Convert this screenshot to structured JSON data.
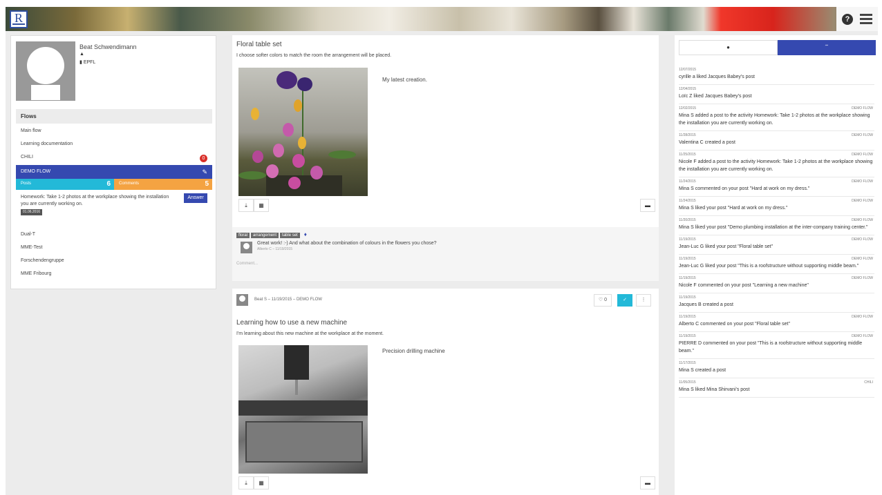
{
  "header": {
    "logo_letter": "R",
    "help_icon_label": "?"
  },
  "profile": {
    "name": "Beat Schwendimann",
    "org": "EPFL"
  },
  "flows": {
    "heading": "Flows",
    "items": [
      {
        "label": "Main flow"
      },
      {
        "label": "Learning documentation"
      },
      {
        "label": "CHILI",
        "badge": "0"
      }
    ],
    "active": {
      "label": "DEMO FLOW",
      "posts_label": "Posts",
      "posts_count": "6",
      "comments_label": "Comments",
      "comments_count": "5",
      "homework_text": "Homework: Take 1-2 photos at the workplace showing the installation you are currently working on.",
      "homework_date": "01.06.2016",
      "answer_label": "Answer"
    },
    "items_after": [
      {
        "label": "Dual-T"
      },
      {
        "label": "MME-Test"
      },
      {
        "label": "Forschendengruppe"
      },
      {
        "label": "MME Fribourg"
      }
    ]
  },
  "posts": [
    {
      "title": "Floral table set",
      "description": "I choose softer colors to match the room the arrangement will be placed.",
      "caption": "My latest creation.",
      "tags": [
        "floral",
        "arrangement",
        "table set"
      ],
      "comment": {
        "text": "Great work! :-) And what about the combination of colours in the flowers you chose?",
        "meta": "Alberto C – 11/19/2015"
      },
      "comment_placeholder": "Comment..."
    },
    {
      "meta": "Beat S – 11/19/2015 – DEMO FLOW",
      "likes": "0",
      "title": "Learning how to use a new machine",
      "description": "I'm learning about this new machine at the workplace at the moment.",
      "caption": "Precision drilling machine"
    }
  ],
  "activity": {
    "items": [
      {
        "date": "12/07/2015",
        "flow": "",
        "text": "cyrille a liked Jacques Babey's post"
      },
      {
        "date": "12/04/2015",
        "flow": "",
        "text": "Loïc Z liked Jacques Babey's post"
      },
      {
        "date": "12/02/2015",
        "flow": "DEMO FLOW",
        "text": "Mina S added a post to the activity Homework: Take 1-2 photos at the workplace showing the installation you are currently working on."
      },
      {
        "date": "11/28/2015",
        "flow": "DEMO FLOW",
        "text": "Valentina C created a post"
      },
      {
        "date": "11/25/2015",
        "flow": "DEMO FLOW",
        "text": "Nicole F added a post to the activity Homework: Take 1-2 photos at the workplace showing the installation you are currently working on."
      },
      {
        "date": "11/24/2015",
        "flow": "DEMO FLOW",
        "text": "Mina S commented on your post \"Hard at work on my dress.\""
      },
      {
        "date": "11/24/2015",
        "flow": "DEMO FLOW",
        "text": "Mina S liked your post \"Hard at work on my dress.\""
      },
      {
        "date": "11/20/2015",
        "flow": "DEMO FLOW",
        "text": "Mina S liked your post \"Demo plumbing installation at the inter-company training center.\""
      },
      {
        "date": "11/19/2015",
        "flow": "DEMO FLOW",
        "text": "Jean-Luc G liked your post \"Floral table set\""
      },
      {
        "date": "11/19/2015",
        "flow": "DEMO FLOW",
        "text": "Jean-Luc G liked your post \"This is a roofstructure without supporting middle beam.\""
      },
      {
        "date": "11/19/2015",
        "flow": "DEMO FLOW",
        "text": "Nicole F commented on your post \"Learning a new machine\""
      },
      {
        "date": "11/19/2015",
        "flow": "",
        "text": "Jacques B created a post"
      },
      {
        "date": "11/19/2015",
        "flow": "DEMO FLOW",
        "text": "Alberto C commented on your post \"Floral table set\""
      },
      {
        "date": "11/19/2015",
        "flow": "DEMO FLOW",
        "text": "PIERRE D commented on your post \"This is a roofstructure without supporting middle beam.\""
      },
      {
        "date": "11/17/2015",
        "flow": "",
        "text": "Mina S created a post"
      },
      {
        "date": "11/05/2015",
        "flow": "CHILI",
        "text": "Mina S liked Mina Shirvani's post"
      }
    ]
  },
  "colors": {
    "primary": "#3549b0",
    "posts": "#23b9d8",
    "comments": "#f4a342",
    "badge": "#d9302a"
  }
}
